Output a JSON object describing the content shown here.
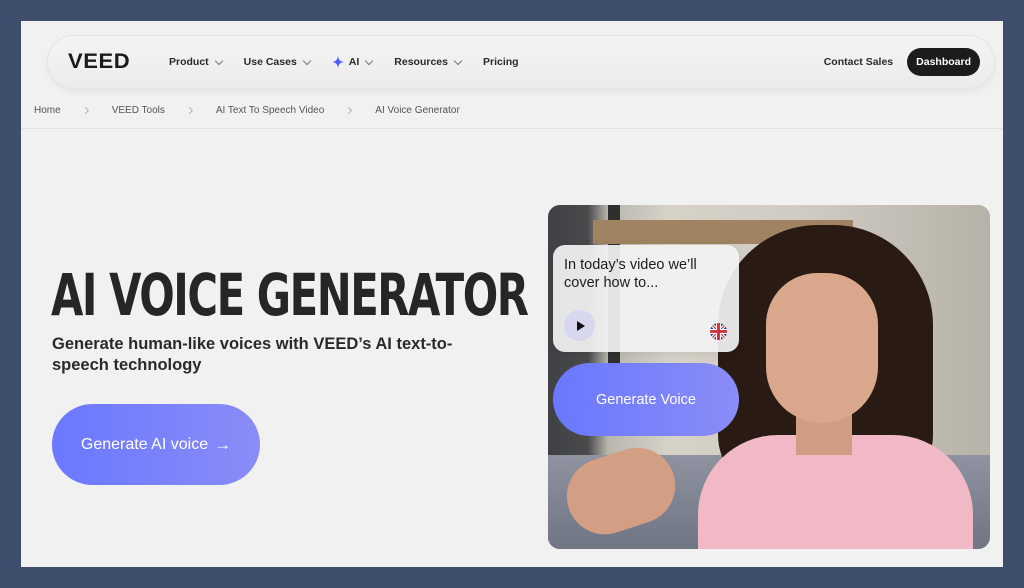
{
  "nav": {
    "logo": "VEED",
    "items": [
      {
        "label": "Product",
        "has_dropdown": true
      },
      {
        "label": "Use Cases",
        "has_dropdown": true
      },
      {
        "label": "AI",
        "has_dropdown": true
      },
      {
        "label": "Resources",
        "has_dropdown": true
      },
      {
        "label": "Pricing",
        "has_dropdown": false
      }
    ],
    "contact_label": "Contact Sales",
    "dashboard_label": "Dashboard"
  },
  "breadcrumb": [
    "Home",
    "VEED Tools",
    "AI Text To Speech Video",
    "AI Voice Generator"
  ],
  "hero": {
    "title": "AI VOICE GENERATOR",
    "subtitle": "Generate human-like voices with VEED’s AI text-to-speech technology",
    "cta_label": "Generate AI voice",
    "cta_arrow": "→"
  },
  "demo": {
    "speech_text": "In today’s video we’ll cover how to...",
    "generate_label": "Generate Voice"
  },
  "colors": {
    "accent_gradient_start": "#6a78ff",
    "accent_gradient_end": "#8a8cf7",
    "dashboard_bg": "#1c1c1c",
    "sparkle": "#4a5cff"
  }
}
